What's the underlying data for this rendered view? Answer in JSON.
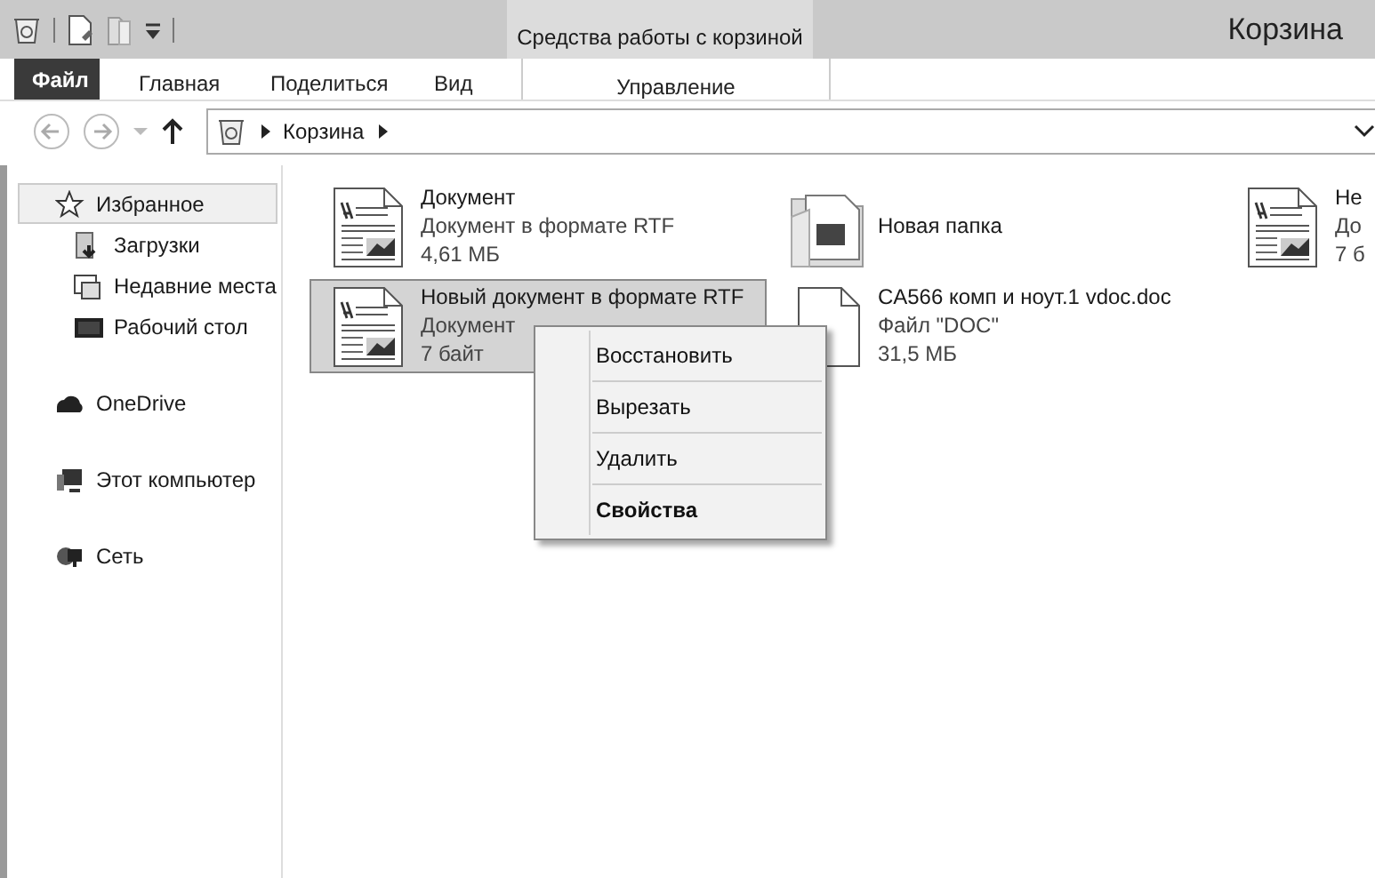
{
  "window": {
    "title": "Корзина"
  },
  "ribbon": {
    "tool_group": "Средства работы с корзиной",
    "tabs": [
      {
        "label": "Файл",
        "kind": "file"
      },
      {
        "label": "Главная",
        "kind": "tab"
      },
      {
        "label": "Поделиться",
        "kind": "tab"
      },
      {
        "label": "Вид",
        "kind": "tab"
      },
      {
        "label": "Управление",
        "kind": "contextual"
      }
    ]
  },
  "address_bar": {
    "path": [
      "Корзина"
    ]
  },
  "sidebar": {
    "items": [
      {
        "label": "Избранное",
        "selected": true,
        "children": [
          {
            "label": "Загрузки",
            "selected": false
          },
          {
            "label": "Недавние места",
            "selected": false
          },
          {
            "label": "Рабочий стол",
            "selected": false
          }
        ]
      },
      {
        "label": "OneDrive",
        "selected": false
      },
      {
        "label": "Этот компьютер",
        "selected": false
      },
      {
        "label": "Сеть",
        "selected": false
      }
    ]
  },
  "files": [
    {
      "kind": "rtf",
      "name": "Документ",
      "type": "Документ в формате RTF",
      "size": "4,61 МБ",
      "selected": false
    },
    {
      "kind": "folder",
      "name": "Новая папка",
      "selected": false
    },
    {
      "kind": "rtf",
      "name": "Не",
      "type": "До",
      "size": "7 б",
      "selected": false
    },
    {
      "kind": "rtf",
      "name": "Новый документ в формате RTF",
      "type": "Документ",
      "size": "7 байт",
      "selected": true
    },
    {
      "kind": "doc",
      "name": "CA566 комп и ноут.1 vdoc.doc",
      "type": "Файл \"DOC\"",
      "size": "31,5 МБ",
      "selected": false
    }
  ],
  "context_menu": {
    "items": [
      {
        "label": "Восстановить",
        "default": false
      },
      {
        "label": "Вырезать",
        "default": false
      },
      {
        "label": "Удалить",
        "default": false
      },
      {
        "label": "Свойства",
        "default": true
      }
    ]
  }
}
